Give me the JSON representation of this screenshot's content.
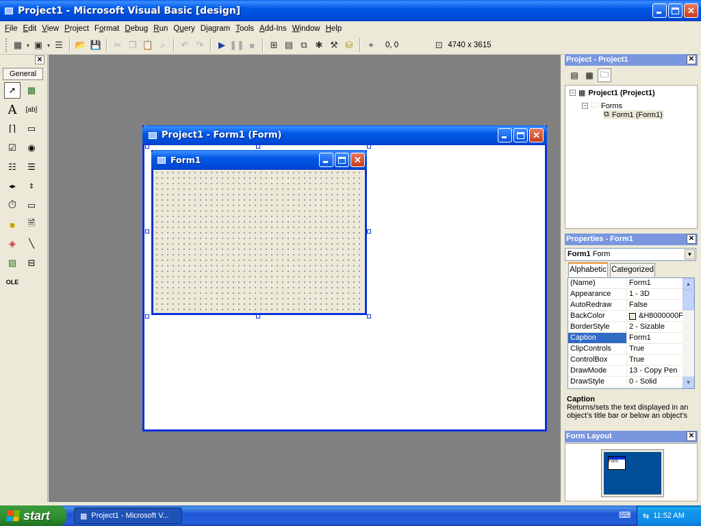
{
  "window": {
    "title": "Project1 - Microsoft Visual Basic [design]"
  },
  "menu": [
    {
      "label": "File",
      "ul": "F",
      "rest": "ile"
    },
    {
      "label": "Edit",
      "ul": "E",
      "rest": "dit"
    },
    {
      "label": "View",
      "ul": "V",
      "rest": "iew"
    },
    {
      "label": "Project",
      "ul": "P",
      "rest": "roject"
    },
    {
      "label": "Format",
      "ul": "o",
      "pre": "F",
      "rest": "rmat"
    },
    {
      "label": "Debug",
      "ul": "D",
      "rest": "ebug"
    },
    {
      "label": "Run",
      "ul": "R",
      "rest": "un"
    },
    {
      "label": "Query",
      "ul": "u",
      "pre": "Q",
      "rest": "ery"
    },
    {
      "label": "Diagram",
      "ul": "i",
      "pre": "D",
      "rest": "agram"
    },
    {
      "label": "Tools",
      "ul": "T",
      "rest": "ools"
    },
    {
      "label": "Add-Ins",
      "ul": "A",
      "rest": "dd-Ins"
    },
    {
      "label": "Window",
      "ul": "W",
      "rest": "indow"
    },
    {
      "label": "Help",
      "ul": "H",
      "rest": "elp"
    }
  ],
  "toolbar": {
    "position": "0, 0",
    "size": "4740 x 3615"
  },
  "toolbox": {
    "tab": "General",
    "close": "✕"
  },
  "designer": {
    "title": "Project1 - Form1 (Form)"
  },
  "form1": {
    "title": "Form1"
  },
  "project": {
    "title": "Project - Project1",
    "tree": {
      "root": "Project1 (Project1)",
      "folder": "Forms",
      "item": "Form1 (Form1)"
    }
  },
  "properties": {
    "title": "Properties - Form1",
    "object": "Form1",
    "object_type": "Form",
    "tabs": [
      "Alphabetic",
      "Categorized"
    ],
    "rows": [
      {
        "name": "(Name)",
        "value": "Form1"
      },
      {
        "name": "Appearance",
        "value": "1 - 3D"
      },
      {
        "name": "AutoRedraw",
        "value": "False"
      },
      {
        "name": "BackColor",
        "value": "&H8000000F"
      },
      {
        "name": "BorderStyle",
        "value": "2 - Sizable"
      },
      {
        "name": "Caption",
        "value": "Form1"
      },
      {
        "name": "ClipControls",
        "value": "True"
      },
      {
        "name": "ControlBox",
        "value": "True"
      },
      {
        "name": "DrawMode",
        "value": "13 - Copy Pen"
      },
      {
        "name": "DrawStyle",
        "value": "0 - Solid"
      }
    ],
    "selected_row": "Caption",
    "description_title": "Caption",
    "description_text": "Returns/sets the text displayed in an object's title bar or below an object's"
  },
  "form_layout": {
    "title": "Form Layout",
    "mini_label": "Form"
  },
  "taskbar": {
    "start": "start",
    "task": "Project1 - Microsoft V...",
    "clock": "11:52 AM"
  },
  "colors": {
    "xp_blue": "#0831d9",
    "panel_title": "#7a96df",
    "workspace": "#808080",
    "selection": "#316ac5"
  }
}
